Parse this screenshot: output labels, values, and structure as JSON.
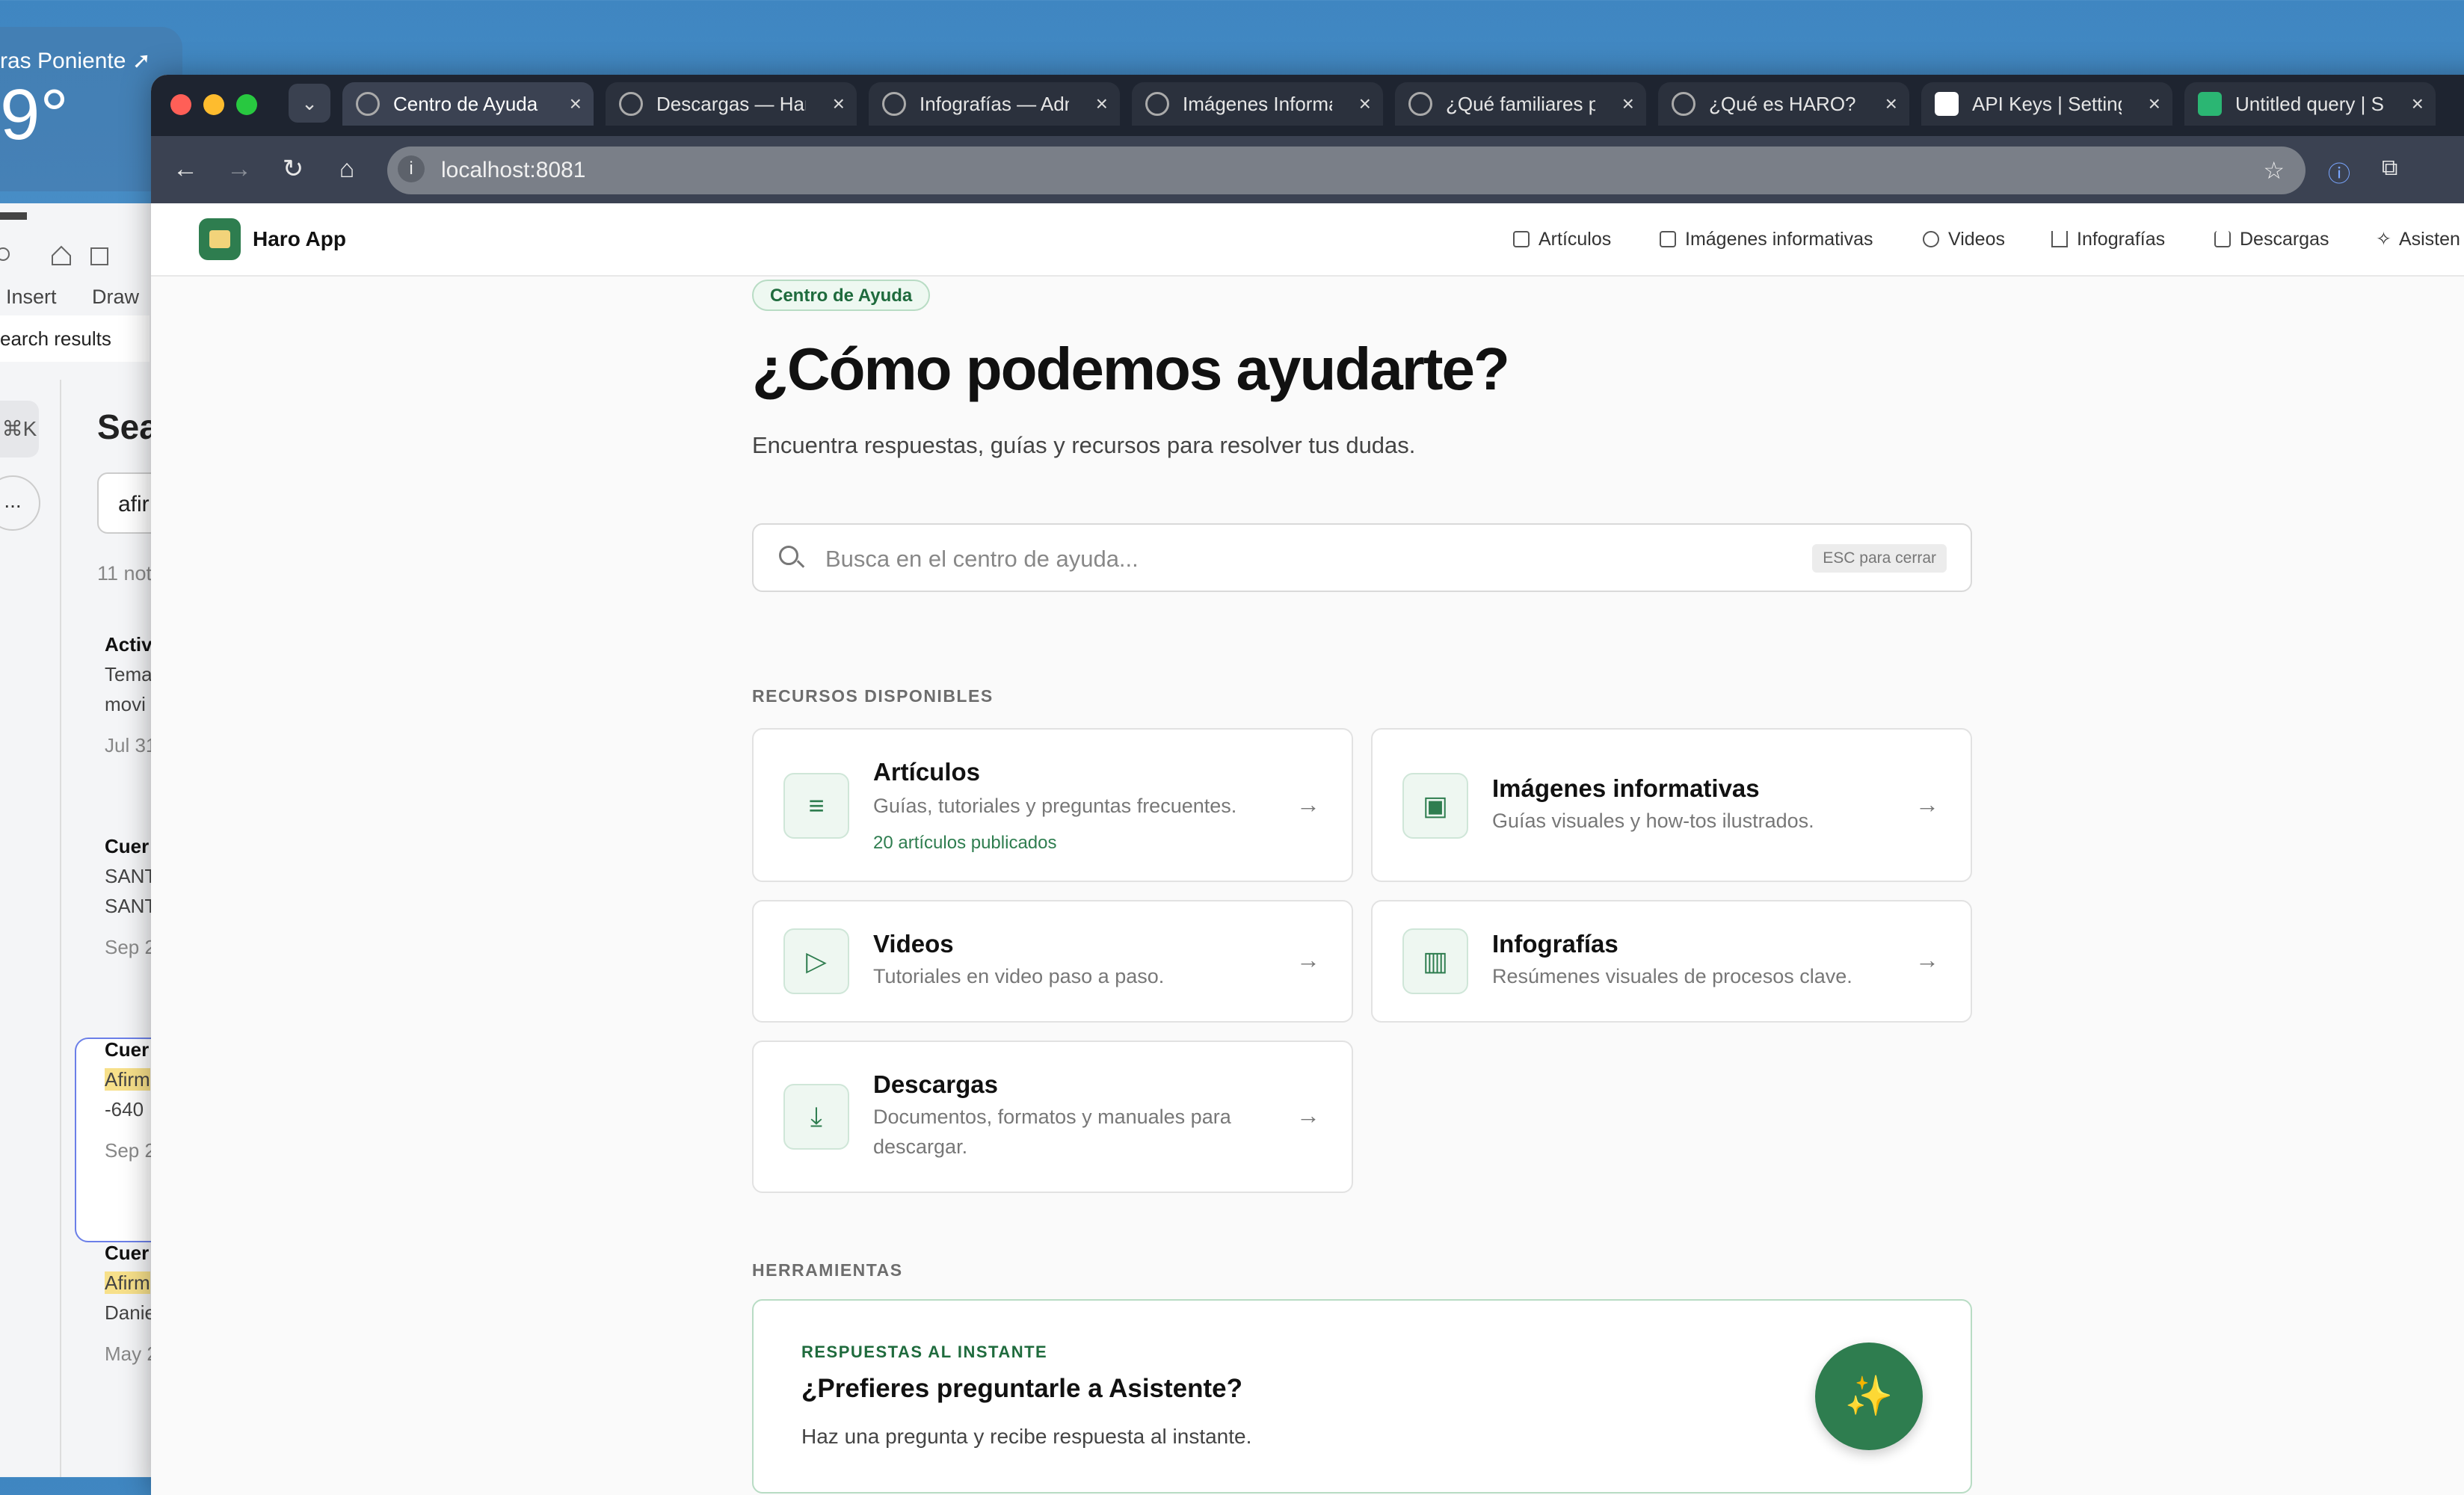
{
  "background_window": {
    "weather_location": "ras Poniente ➚",
    "weather_temp": "9°",
    "menu": [
      "Insert",
      "Draw"
    ],
    "search_results_label": "earch results",
    "shortcut_label": "⌘K",
    "more_label": "...",
    "search_title": "Sea",
    "search_value": "afir",
    "count_label": "11 not",
    "notes": [
      {
        "title": "Activ",
        "line1": "Tema",
        "line2": "movi",
        "date": "Jul 31"
      },
      {
        "title": "Cuer",
        "line1": "SANT",
        "line2": "SANT",
        "date": "Sep 2"
      },
      {
        "title": "Cuer",
        "line1": "Afirm",
        "line2": "-640",
        "date": "Sep 2"
      },
      {
        "title": "Cuer",
        "line1": "Afirm",
        "line2": "Danie",
        "date": "May 2"
      }
    ]
  },
  "browser": {
    "tabs": [
      {
        "label": "Centro de Ayuda —",
        "active": true
      },
      {
        "label": "Descargas — Haro",
        "active": false
      },
      {
        "label": "Infografías — Admi",
        "active": false
      },
      {
        "label": "Imágenes Informat",
        "active": false
      },
      {
        "label": "¿Qué familiares pu",
        "active": false
      },
      {
        "label": "¿Qué es HARO? —",
        "active": false
      },
      {
        "label": "API Keys | Settings",
        "active": false
      },
      {
        "label": "Untitled query | SQ",
        "active": false
      }
    ],
    "url": "localhost:8081"
  },
  "app": {
    "brand": "Haro App",
    "nav": [
      {
        "label": "Artículos",
        "icon": "article-icon"
      },
      {
        "label": "Imágenes informativas",
        "icon": "image-icon"
      },
      {
        "label": "Videos",
        "icon": "play-icon"
      },
      {
        "label": "Infografías",
        "icon": "bar-chart-icon"
      },
      {
        "label": "Descargas",
        "icon": "download-icon"
      },
      {
        "label": "Asisten",
        "icon": "sparkle-icon"
      }
    ],
    "badge": "Centro de Ayuda",
    "title": "¿Cómo podemos ayudarte?",
    "subtitle": "Encuentra respuestas, guías y recursos para resolver tus dudas.",
    "search": {
      "placeholder": "Busca en el centro de ayuda...",
      "hint": "ESC para cerrar"
    },
    "resources_label": "RECURSOS DISPONIBLES",
    "cards": [
      {
        "title": "Artículos",
        "desc": "Guías, tutoriales y preguntas frecuentes.",
        "meta": "20 artículos publicados",
        "icon": "article-icon"
      },
      {
        "title": "Imágenes informativas",
        "desc": "Guías visuales y how-tos ilustrados.",
        "icon": "image-icon"
      },
      {
        "title": "Videos",
        "desc": "Tutoriales en video paso a paso.",
        "icon": "play-icon"
      },
      {
        "title": "Infografías",
        "desc": "Resúmenes visuales de procesos clave.",
        "icon": "bar-chart-icon"
      },
      {
        "title": "Descargas",
        "desc": "Documentos, formatos y manuales para descargar.",
        "icon": "download-icon"
      }
    ],
    "tools_label": "HERRAMIENTAS",
    "assistant": {
      "eyebrow": "RESPUESTAS AL INSTANTE",
      "title": "¿Prefieres preguntarle a Asistente?",
      "desc": "Haz una pregunta y recibe respuesta al instante.",
      "fab_icon": "✨"
    }
  },
  "colors": {
    "accent": "#2e7d4f",
    "accent_soft": "#eef7f1",
    "tabbar": "#1e2430"
  }
}
